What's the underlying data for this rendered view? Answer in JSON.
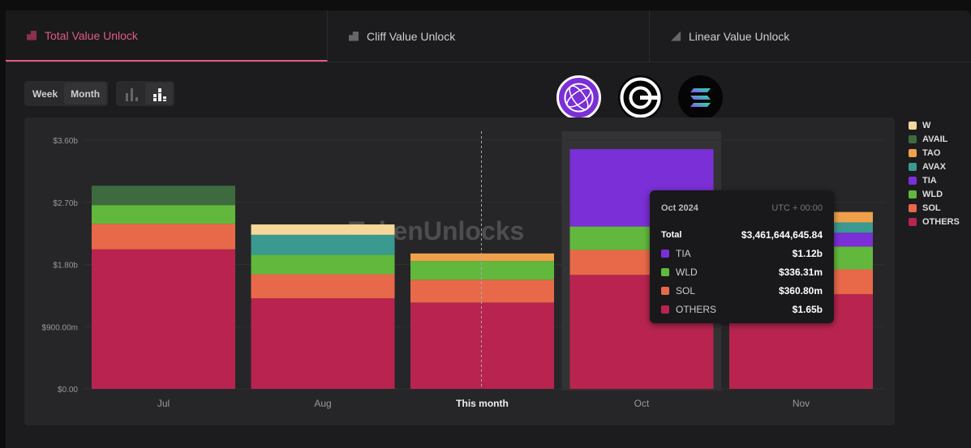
{
  "tabs": [
    {
      "label": "Total Value Unlock",
      "icon": "stacked-chart-icon",
      "active": true
    },
    {
      "label": "Cliff Value Unlock",
      "icon": "step-chart-icon"
    },
    {
      "label": "Linear Value Unlock",
      "icon": "ramp-chart-icon"
    }
  ],
  "period": {
    "options": [
      "Week",
      "Month"
    ],
    "selected": "Month"
  },
  "view_toggle": {
    "options": [
      "bar-chart-icon",
      "stacked-bar-chart-icon"
    ],
    "selected": "stacked-bar-chart-icon"
  },
  "logos": [
    "celestia-logo",
    "worldcoin-logo",
    "solana-logo"
  ],
  "watermark": "TokenUnlocks",
  "tooltip": {
    "title": "Oct 2024",
    "timezone": "UTC + 00:00",
    "total_label": "Total",
    "total": "$3,461,644,645.84",
    "rows": [
      {
        "name": "TIA",
        "value": "$1.12b",
        "color": "#7b2fd6"
      },
      {
        "name": "WLD",
        "value": "$336.31m",
        "color": "#62b83c"
      },
      {
        "name": "SOL",
        "value": "$360.80m",
        "color": "#e8694a"
      },
      {
        "name": "OTHERS",
        "value": "$1.65b",
        "color": "#b8244f"
      }
    ]
  },
  "chart_data": {
    "type": "bar",
    "stacked": true,
    "categories": [
      "Jul",
      "Aug",
      "This month",
      "Oct",
      "Nov"
    ],
    "highlighted_category": "Oct",
    "current_category": "This month",
    "yticks": [
      "$0.00",
      "$900.00m",
      "$1.80b",
      "$2.70b",
      "$3.60b"
    ],
    "ylim": [
      0,
      3.6
    ],
    "yunit": "billion USD",
    "legend": "right",
    "series": [
      {
        "name": "OTHERS",
        "color": "#b8244f",
        "values": [
          2.02,
          1.31,
          1.25,
          1.65,
          1.37
        ]
      },
      {
        "name": "SOL",
        "color": "#e8694a",
        "values": [
          0.37,
          0.35,
          0.33,
          0.36,
          0.36
        ]
      },
      {
        "name": "WLD",
        "color": "#62b83c",
        "values": [
          0.27,
          0.28,
          0.27,
          0.34,
          0.33
        ]
      },
      {
        "name": "TIA",
        "color": "#7b2fd6",
        "values": [
          0,
          0,
          0,
          1.12,
          0.2
        ]
      },
      {
        "name": "AVAX",
        "color": "#3a9a90",
        "values": [
          0,
          0.29,
          0,
          0,
          0.15
        ]
      },
      {
        "name": "TAO",
        "color": "#f0a04b",
        "values": [
          0,
          0,
          0.11,
          0,
          0.15
        ]
      },
      {
        "name": "AVAIL",
        "color": "#3d6b3f",
        "values": [
          0.28,
          0,
          0,
          0,
          0
        ]
      },
      {
        "name": "W",
        "color": "#f5d79a",
        "values": [
          0,
          0.15,
          0,
          0,
          0
        ]
      }
    ],
    "legend_order": [
      "W",
      "AVAIL",
      "TAO",
      "AVAX",
      "TIA",
      "WLD",
      "SOL",
      "OTHERS"
    ]
  }
}
